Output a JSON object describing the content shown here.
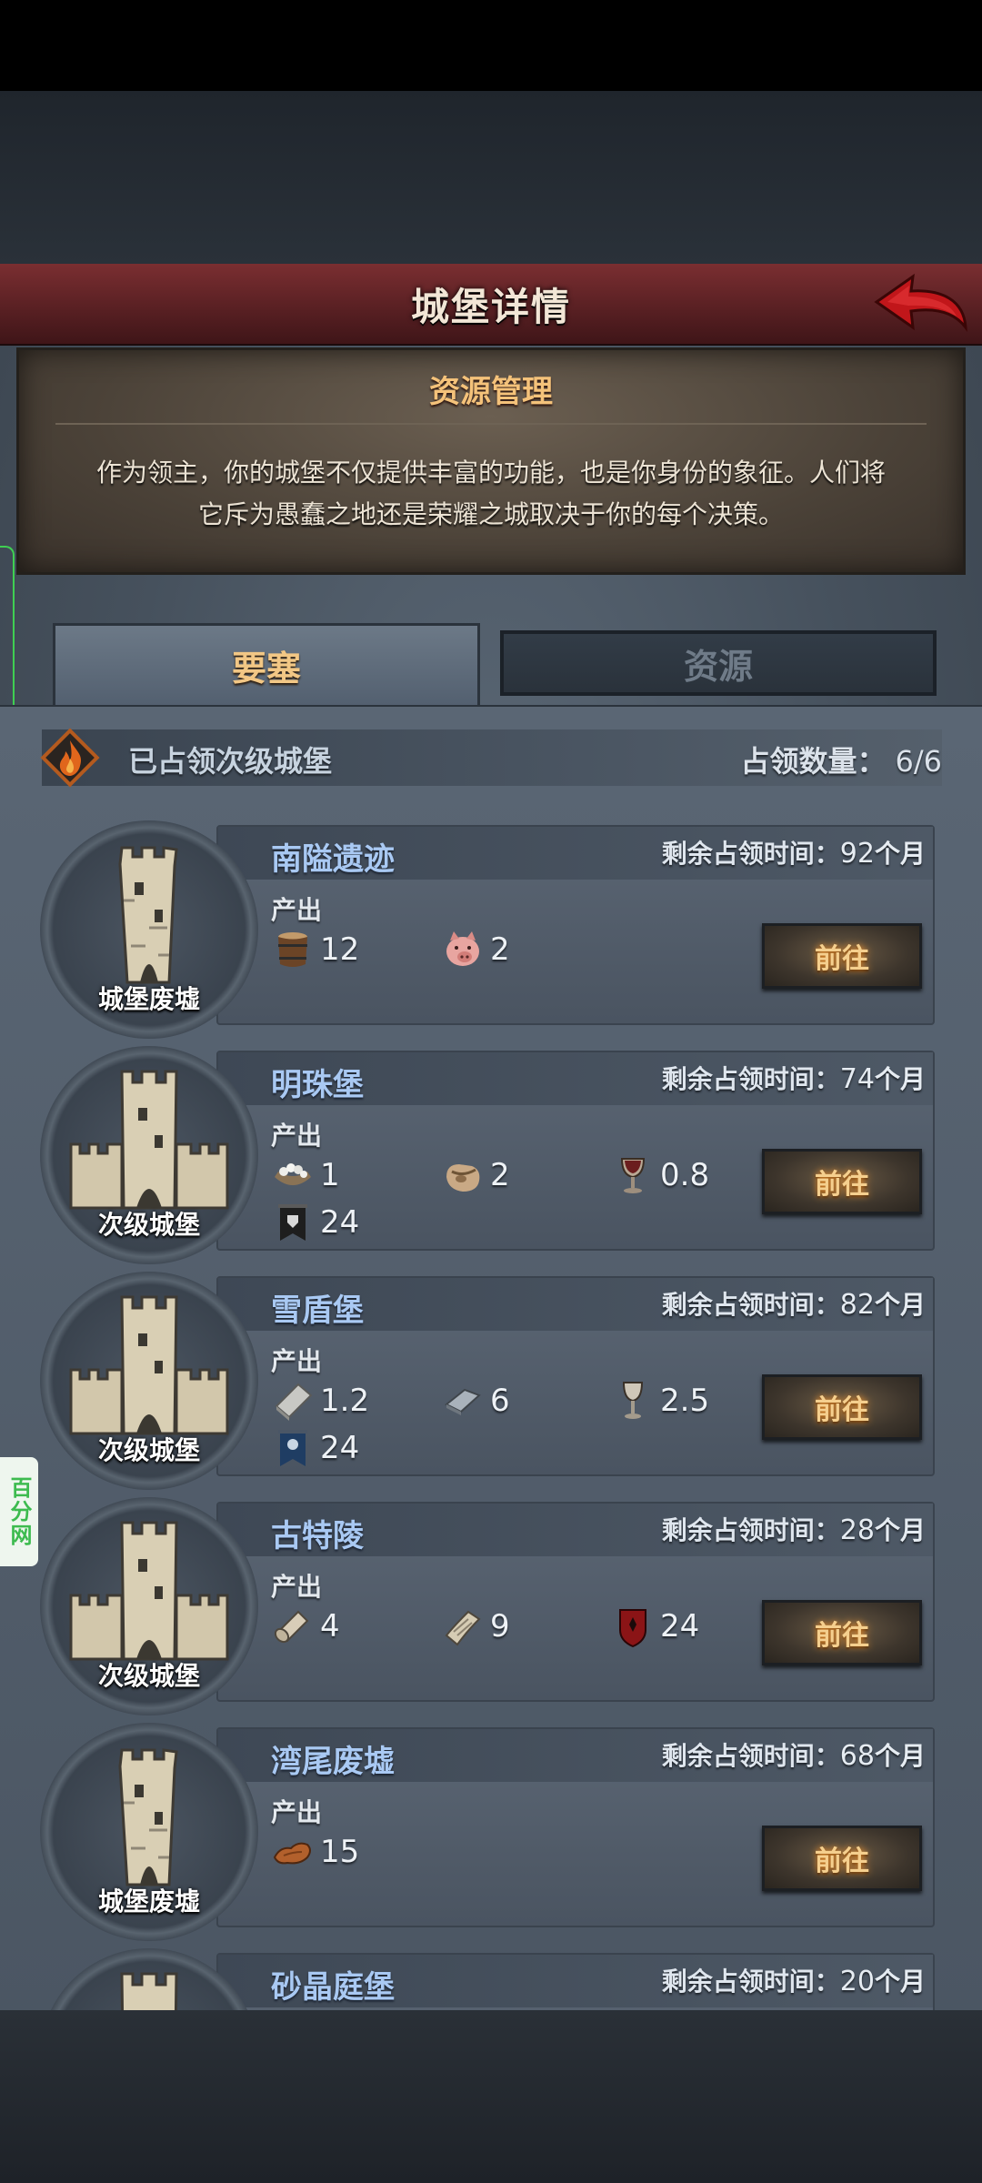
{
  "header": {
    "title": "城堡详情"
  },
  "info": {
    "title": "资源管理",
    "description_line1": "作为领主，你的城堡不仅提供丰富的功能，也是你身份的象征。人们将",
    "description_line2": "它斥为愚蠢之地还是荣耀之城取决于你的每个决策。"
  },
  "tabs": [
    {
      "label": "要塞"
    },
    {
      "label": "资源"
    }
  ],
  "section": {
    "title": "已占领次级城堡",
    "count_label": "占领数量：",
    "count_value": "6/6"
  },
  "side_badge": {
    "text": "百分网"
  },
  "labels": {
    "output": "产出",
    "remaining": "剩余占领时间：",
    "goto": "前往",
    "months": "个月"
  },
  "castles": [
    {
      "name": "南隘遗迹",
      "type": "城堡废墟",
      "remaining": "92",
      "resources": [
        {
          "icon": "barrel-icon",
          "value": "12"
        },
        {
          "icon": "pig-icon",
          "value": "2"
        }
      ]
    },
    {
      "name": "明珠堡",
      "type": "次级城堡",
      "remaining": "74",
      "resources": [
        {
          "icon": "pearl-basket-icon",
          "value": "1"
        },
        {
          "icon": "sack-icon",
          "value": "2"
        },
        {
          "icon": "goblet-icon",
          "value": "0.8"
        },
        {
          "icon": "banner-icon",
          "value": "24"
        }
      ]
    },
    {
      "name": "雪盾堡",
      "type": "次级城堡",
      "remaining": "82",
      "resources": [
        {
          "icon": "stone-slab-icon",
          "value": "1.2"
        },
        {
          "icon": "iron-ingot-icon",
          "value": "6"
        },
        {
          "icon": "silver-goblet-icon",
          "value": "2.5"
        },
        {
          "icon": "blue-banner-icon",
          "value": "24"
        }
      ]
    },
    {
      "name": "古特陵",
      "type": "次级城堡",
      "remaining": "28",
      "resources": [
        {
          "icon": "scroll-icon",
          "value": "4"
        },
        {
          "icon": "parchment-icon",
          "value": "9"
        },
        {
          "icon": "red-shield-icon",
          "value": "24"
        }
      ]
    },
    {
      "name": "湾尾废墟",
      "type": "城堡废墟",
      "remaining": "68",
      "resources": [
        {
          "icon": "leather-icon",
          "value": "15"
        }
      ]
    },
    {
      "name": "砂晶庭堡",
      "type": "",
      "remaining": "20",
      "resources": []
    }
  ],
  "colors": {
    "accent_gold": "#f5cf8e",
    "castle_name_blue": "#a9c9f3",
    "title_red": "#7a2e31"
  }
}
